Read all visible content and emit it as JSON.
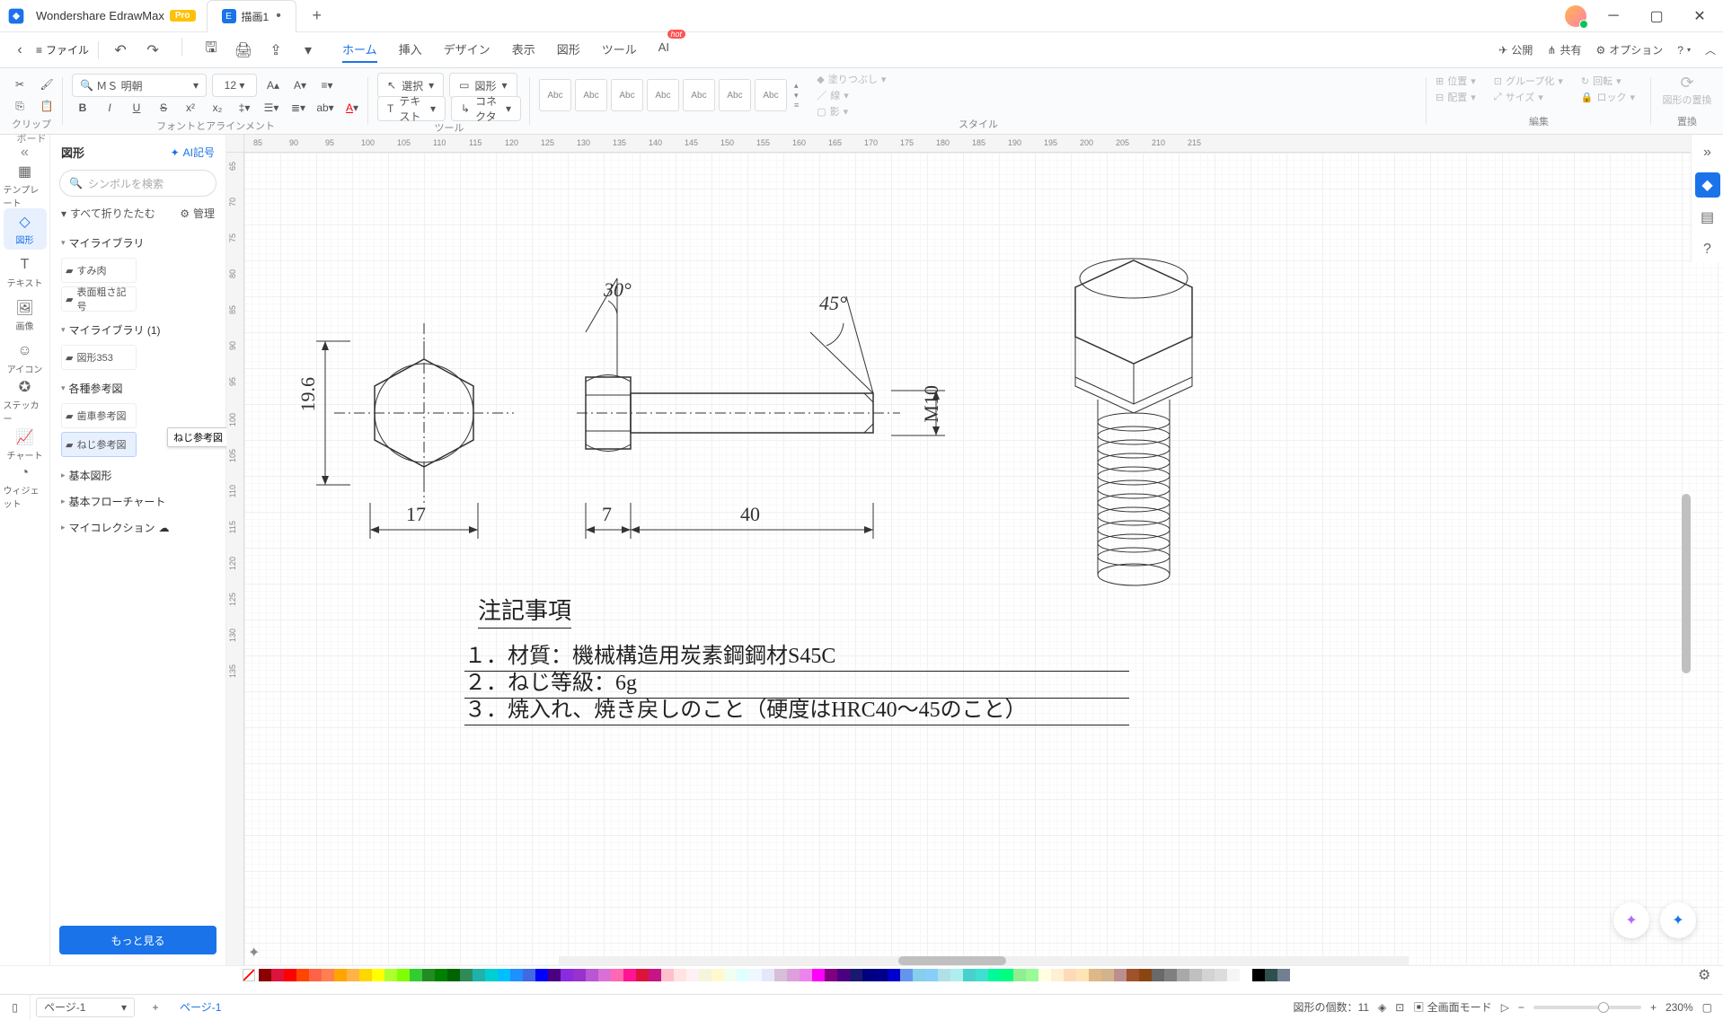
{
  "app": {
    "name": "Wondershare EdrawMax",
    "badge": "Pro"
  },
  "doc": {
    "title": "描画1",
    "dirty": "•"
  },
  "file_menu": "ファイル",
  "menu_tabs": [
    "ホーム",
    "挿入",
    "デザイン",
    "表示",
    "図形",
    "ツール",
    "AI"
  ],
  "hot": "hot",
  "top_right": {
    "publish": "公開",
    "share": "共有",
    "option": "オプション"
  },
  "ribbon": {
    "clipboard": "クリップボード",
    "font_align": "フォントとアラインメント",
    "tool": "ツール",
    "style": "スタイル",
    "edit": "編集",
    "replace": "置換",
    "font_name": "ＭＳ 明朝",
    "font_size": "12",
    "select": "選択",
    "shape": "図形",
    "text_btn": "テキスト",
    "connector": "コネクタ",
    "abc": "Abc",
    "fill": "塗りつぶし",
    "line_s": "線",
    "shadow": "影",
    "position": "位置",
    "align_d": "配置",
    "group": "グループ化",
    "size": "サイズ",
    "rotate": "回転",
    "lock": "ロック",
    "shape_replace": "図形の置換"
  },
  "left_rail": {
    "template": "テンプレート",
    "shape": "図形",
    "text": "テキスト",
    "image": "画像",
    "icon": "アイコン",
    "sticker": "ステッカー",
    "chart": "チャート",
    "widget": "ウィジェット"
  },
  "shape_panel": {
    "title": "図形",
    "ai": "AI記号",
    "search_ph": "シンボルを検索",
    "collapse_all": "すべて折りたたむ",
    "manage": "管理",
    "sec1": "マイライブラリ",
    "sec1_items": [
      "すみ肉",
      "表面粗さ記号"
    ],
    "sec2": "マイライブラリ (1)",
    "sec2_items": [
      "図形353"
    ],
    "sec3": "各種参考図",
    "sec3_items": [
      "歯車参考図",
      "ねじ参考図"
    ],
    "sec3_tooltip": "ねじ参考図",
    "sec4": "基本図形",
    "sec5": "基本フローチャート",
    "sec6": "マイコレクション",
    "more": "もっと見る"
  },
  "canvas": {
    "ruler_h": [
      85,
      90,
      95,
      100,
      105,
      110,
      115,
      120,
      125,
      130,
      135,
      140,
      145,
      150,
      155,
      160,
      165,
      170,
      175,
      180,
      185,
      190,
      195,
      200,
      205,
      210,
      215
    ],
    "ruler_v": [
      65,
      70,
      75,
      80,
      85,
      90,
      95,
      100,
      105,
      110,
      115,
      120,
      125,
      130,
      135
    ],
    "angle1": "30°",
    "angle2": "45°",
    "dim_h": "19.6",
    "dim_17": "17",
    "dim_7": "7",
    "dim_40": "40",
    "thread": "M10",
    "notes_title": "注記事項",
    "notes": [
      "１．材質：機械構造用炭素鋼鋼材S45C",
      "２．ねじ等級：6g",
      "３．焼入れ、焼き戻しのこと（硬度はHRC40～45のこと）"
    ]
  },
  "status": {
    "page_sel": "ページ-1",
    "page_tab": "ページ-1",
    "shape_count_label": "図形の個数：",
    "shape_count": "11",
    "fullscreen": "全画面モード",
    "zoom": "230%"
  }
}
